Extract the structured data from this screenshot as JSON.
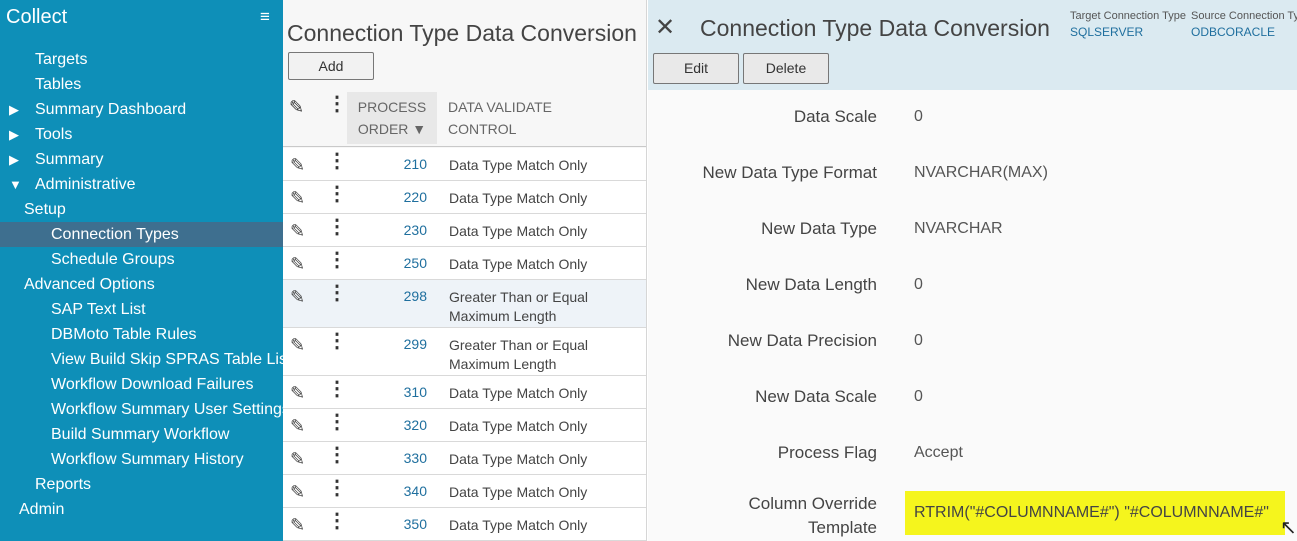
{
  "sidebar": {
    "app_title": "Collect",
    "menu_icon": "hamburger-icon",
    "items": [
      {
        "label": "Targets",
        "indent": 2
      },
      {
        "label": "Tables",
        "indent": 2
      },
      {
        "label": "Summary Dashboard",
        "indent": 2,
        "expander": "collapsed"
      },
      {
        "label": "Tools",
        "indent": 2,
        "expander": "collapsed"
      },
      {
        "label": "Summary",
        "indent": 2,
        "expander": "collapsed"
      },
      {
        "label": "Administrative",
        "indent": 2,
        "expander": "expanded"
      },
      {
        "label": "Setup",
        "indent": 1
      },
      {
        "label": "Connection Types",
        "indent": 3,
        "active": true
      },
      {
        "label": "Schedule Groups",
        "indent": 3
      },
      {
        "label": "Advanced Options",
        "indent": 1
      },
      {
        "label": "SAP Text List",
        "indent": 3
      },
      {
        "label": "DBMoto Table Rules",
        "indent": 3
      },
      {
        "label": "View Build Skip SPRAS Table List",
        "indent": 3
      },
      {
        "label": "Workflow Download Failures",
        "indent": 3
      },
      {
        "label": "Workflow Summary User Settings",
        "indent": 3
      },
      {
        "label": "Build Summary Workflow",
        "indent": 3
      },
      {
        "label": "Workflow Summary History",
        "indent": 3
      },
      {
        "label": "Reports",
        "indent": 2
      },
      {
        "label": "Admin",
        "indent": 0
      }
    ]
  },
  "list_panel": {
    "title": "Connection Type Data Conversion",
    "add_label": "Add",
    "headers": {
      "process_order_1": "PROCESS",
      "process_order_2": "ORDER ▼",
      "data_validate_1": "DATA VALIDATE",
      "data_validate_2": "CONTROL"
    },
    "rows": [
      {
        "order": "210",
        "validate": "Data Type Match Only"
      },
      {
        "order": "220",
        "validate": "Data Type Match Only"
      },
      {
        "order": "230",
        "validate": "Data Type Match Only"
      },
      {
        "order": "250",
        "validate": "Data Type Match Only"
      },
      {
        "order": "298",
        "validate": "Greater Than or Equal Maximum Length",
        "highlight": true
      },
      {
        "order": "299",
        "validate": "Greater Than or Equal Maximum Length"
      },
      {
        "order": "310",
        "validate": "Data Type Match Only"
      },
      {
        "order": "320",
        "validate": "Data Type Match Only"
      },
      {
        "order": "330",
        "validate": "Data Type Match Only"
      },
      {
        "order": "340",
        "validate": "Data Type Match Only"
      },
      {
        "order": "350",
        "validate": "Data Type Match Only"
      }
    ]
  },
  "detail": {
    "close_icon": "close-icon",
    "title": "Connection Type Data Conversion",
    "target_label": "Target Connection Type",
    "target_value": "SQLSERVER",
    "source_label": "Source Connection Type",
    "source_value": "ODBCORACLE",
    "edit_label": "Edit",
    "delete_label": "Delete",
    "fields": [
      {
        "label": "Data Scale",
        "value": "0"
      },
      {
        "label": "New Data Type Format",
        "value": "NVARCHAR(MAX)"
      },
      {
        "label": "New Data Type",
        "value": "NVARCHAR"
      },
      {
        "label": "New Data Length",
        "value": "0"
      },
      {
        "label": "New Data Precision",
        "value": "0"
      },
      {
        "label": "New Data Scale",
        "value": "0"
      },
      {
        "label": "Process Flag",
        "value": "Accept"
      }
    ],
    "override_label_1": "Column Override",
    "override_label_2": "Template",
    "override_value": "RTRIM(\"#COLUMNNAME#\") \"#COLUMNNAME#\""
  },
  "colors": {
    "sidebar_bg": "#0e8fb8",
    "sidebar_active": "#3e6f8f",
    "header_bg": "#dbeaf1",
    "highlight": "#f5f51d",
    "link": "#1f6f9e"
  }
}
